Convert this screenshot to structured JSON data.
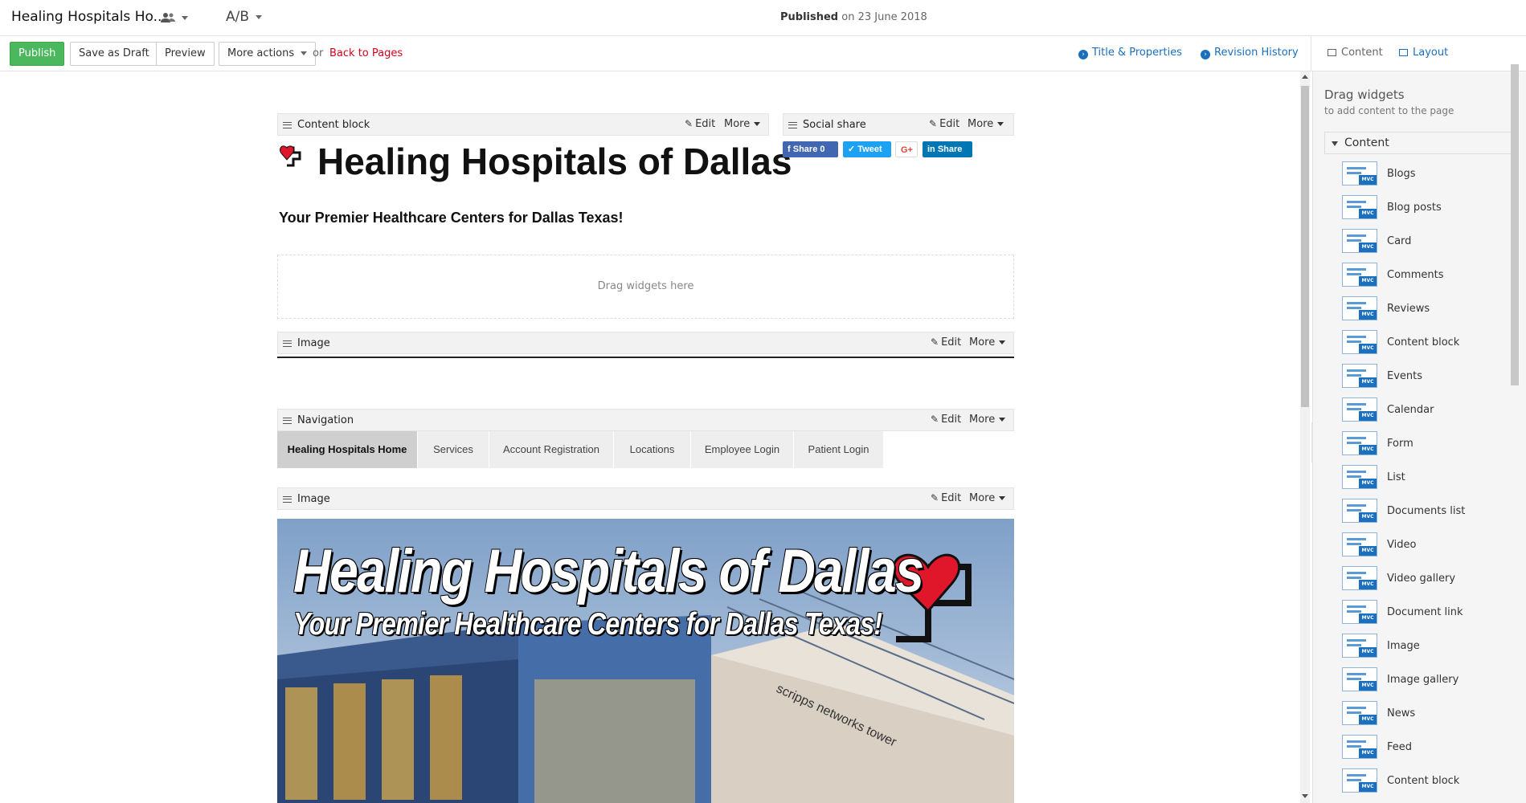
{
  "header": {
    "page_name": "Healing Hospitals Ho...",
    "ab_label": "A/B",
    "published_label": "Published",
    "published_date": "on 23 June 2018"
  },
  "toolbar": {
    "publish": "Publish",
    "save_draft": "Save as Draft",
    "preview": "Preview",
    "more_actions": "More actions",
    "or": "or",
    "back": "Back to Pages",
    "title_properties": "Title & Properties",
    "revision_history": "Revision History",
    "mode_content": "Content",
    "mode_layout": "Layout"
  },
  "colors": {
    "publish_green": "#4cb85e",
    "link_blue": "#1a6fbf",
    "back_red": "#d0021b",
    "logo_red": "#e0162b"
  },
  "widgets": {
    "edit_label": "Edit",
    "more_label": "More",
    "content_block": "Content block",
    "social_share": "Social share",
    "image1": "Image",
    "navigation": "Navigation",
    "image2": "Image"
  },
  "page": {
    "heading": "Healing Hospitals of Dallas",
    "subheading": "Your Premier Healthcare Centers for Dallas Texas!",
    "drop_zone": "Drag widgets here"
  },
  "social": {
    "facebook": "Share 0",
    "twitter": "Tweet",
    "google": "G+",
    "linkedin": "Share"
  },
  "navigation": {
    "items": [
      "Healing Hospitals Home",
      "Services",
      "Account Registration",
      "Locations",
      "Employee Login",
      "Patient Login"
    ]
  },
  "banner": {
    "title": "Healing Hospitals of Dallas",
    "subtitle": "Your Premier Healthcare Centers for Dallas Texas!",
    "building_sign": "scripps networks tower"
  },
  "sidebar": {
    "title": "Drag widgets",
    "subtitle": "to add content to the page",
    "section": "Content",
    "mvc_tag": "MVC",
    "items": [
      "Blogs",
      "Blog posts",
      "Card",
      "Comments",
      "Reviews",
      "Content block",
      "Events",
      "Calendar",
      "Form",
      "List",
      "Documents list",
      "Video",
      "Video gallery",
      "Document link",
      "Image",
      "Image gallery",
      "News",
      "Feed",
      "Content block"
    ]
  }
}
